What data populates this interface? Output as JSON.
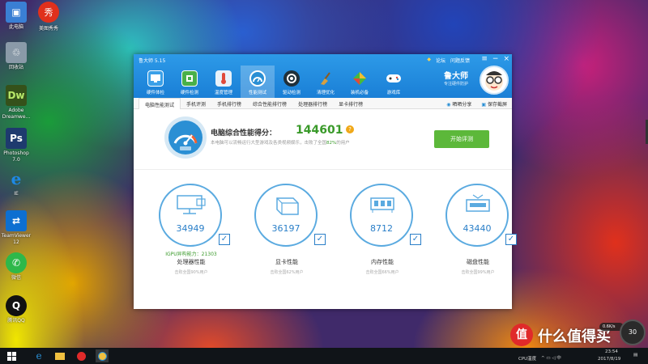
{
  "desktop": {
    "icons": [
      {
        "label": "此电脑",
        "color": "#3a7fd4",
        "glyph": "▣"
      },
      {
        "label": "回收站",
        "color": "#8a9aa8",
        "glyph": "🗑"
      },
      {
        "label": "Adobe Dreamwe...",
        "color": "#35511a",
        "glyph": "Dw"
      },
      {
        "label": "Photoshop 7.0",
        "color": "#1e3a6e",
        "glyph": "Ps"
      },
      {
        "label": "IE",
        "color": "#1e88e5",
        "glyph": "e"
      },
      {
        "label": "TeamViewer 12",
        "color": "#0d6fd1",
        "glyph": "⇄"
      },
      {
        "label": "微信",
        "color": "#2eb84a",
        "glyph": "✆"
      },
      {
        "label": "腾讯QQ",
        "color": "#111111",
        "glyph": "Q"
      }
    ],
    "second_icon": {
      "label": "美图秀秀",
      "color": "#e0301c",
      "glyph": "秀"
    }
  },
  "window": {
    "app_title": "鲁大师 5.15",
    "top_links": [
      "论坛",
      "问题反馈"
    ],
    "nav": [
      {
        "label": "硬件体检",
        "color": "#3aa0e8"
      },
      {
        "label": "硬件检测",
        "color": "#49b04a"
      },
      {
        "label": "温度管理",
        "color": "#e8f2fa"
      },
      {
        "label": "性能测试",
        "color": "#2a8fd4"
      },
      {
        "label": "驱动检测",
        "color": "#20303a"
      },
      {
        "label": "清理优化",
        "color": "#c08a30"
      },
      {
        "label": "装机必备",
        "color": "#4ab83a"
      },
      {
        "label": "游戏库",
        "color": "#ffffff"
      }
    ],
    "brand_name": "鲁大师",
    "brand_sub": "专注硬件防护",
    "subtabs": [
      "电脑性能测试",
      "手机评测",
      "手机排行榜",
      "综合性能排行榜",
      "处理器排行榜",
      "显卡排行榜"
    ],
    "subtab_right": [
      "晒晒分享",
      "保存截屏"
    ],
    "score_label": "电脑综合性能得分：",
    "score_value": "144601",
    "score_desc_pre": "本电脑可以流畅运行大型游戏及各类视频娱乐，击败了全国",
    "score_pct": "82%",
    "score_desc_post": "的用户",
    "start_button": "开始评测",
    "cards": [
      {
        "value": "34949",
        "extra": "IGPU异构能力：21303",
        "title": "处理器性能",
        "sub": "击败全国90%用户"
      },
      {
        "value": "36197",
        "extra": "",
        "title": "显卡性能",
        "sub": "击败全国62%用户"
      },
      {
        "value": "8712",
        "extra": "",
        "title": "内存性能",
        "sub": "击败全国66%用户"
      },
      {
        "value": "43440",
        "extra": "",
        "title": "磁盘性能",
        "sub": "击败全国99%用户"
      }
    ]
  },
  "taskbar": {
    "cpu_label": "CPU温度",
    "time": "23:54",
    "date": "2017/8/19",
    "net_speed": "0.6K/s",
    "widget_value": "30"
  },
  "watermark": {
    "text": "什么值得买",
    "badge": "值"
  }
}
